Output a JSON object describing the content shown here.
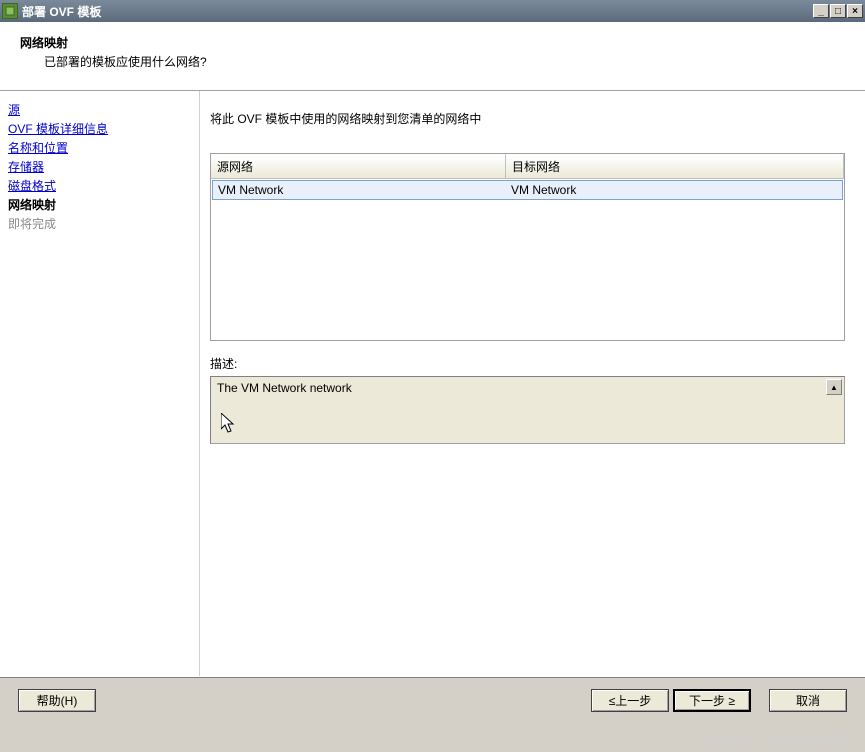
{
  "window": {
    "title": "部署 OVF 模板"
  },
  "header": {
    "title": "网络映射",
    "subtitle": "已部署的模板应使用什么网络?"
  },
  "sidebar": {
    "items": [
      {
        "label": "源",
        "state": "link"
      },
      {
        "label": "OVF 模板详细信息",
        "state": "link"
      },
      {
        "label": "名称和位置",
        "state": "link"
      },
      {
        "label": "存储器",
        "state": "link"
      },
      {
        "label": "磁盘格式",
        "state": "link"
      },
      {
        "label": "网络映射",
        "state": "current"
      },
      {
        "label": "即将完成",
        "state": "disabled"
      }
    ]
  },
  "main": {
    "instruction": "将此 OVF 模板中使用的网络映射到您清单的网络中",
    "table": {
      "headers": {
        "source": "源网络",
        "target": "目标网络"
      },
      "rows": [
        {
          "source": "VM Network",
          "target": "VM Network"
        }
      ]
    },
    "descLabel": "描述:",
    "descText": "The VM Network network"
  },
  "footer": {
    "help": "帮助(H)",
    "back": "≤上一步",
    "next": "下一步 ≥",
    "cancel": "取消"
  },
  "watermark": "CSDN @ 飞不起来的肥猫゛"
}
